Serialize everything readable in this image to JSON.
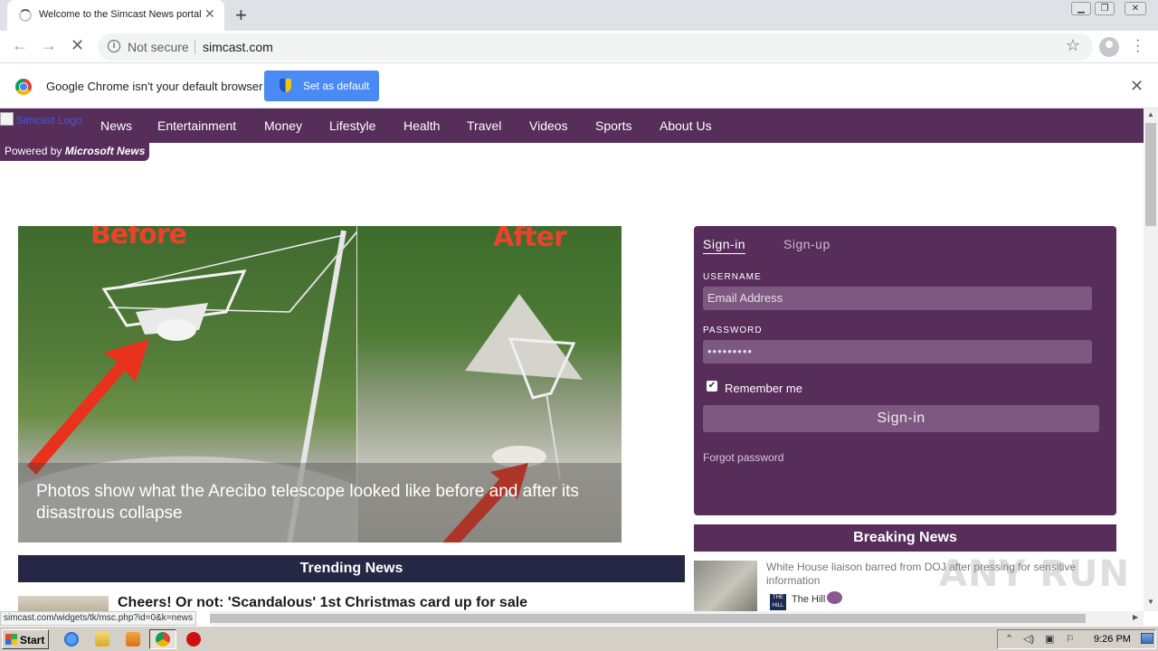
{
  "browser": {
    "tab_title": "Welcome to the Simcast News portal",
    "security_label": "Not secure",
    "url": "simcast.com",
    "infobar_message": "Google Chrome isn't your default browser",
    "set_default_label": "Set as default"
  },
  "site": {
    "logo_alt": "Simcast Logo",
    "nav": [
      "News",
      "Entertainment",
      "Money",
      "Lifestyle",
      "Health",
      "Travel",
      "Videos",
      "Sports",
      "About Us"
    ],
    "powered_prefix": "Powered by",
    "powered_brand": "Microsoft News"
  },
  "hero": {
    "before_label": "Before",
    "after_label": "After",
    "caption": "Photos show what the Arecibo telescope looked like before and after its disastrous collapse"
  },
  "trending": {
    "title": "Trending News",
    "headline": "Cheers! Or not: 'Scandalous' 1st Christmas card up for sale"
  },
  "signin": {
    "tab_signin": "Sign-in",
    "tab_signup": "Sign-up",
    "username_label": "USERNAME",
    "username_placeholder": "Email Address",
    "password_label": "PASSWORD",
    "password_value": "•••••••••",
    "remember_label": "Remember me",
    "remember_checked": true,
    "submit_label": "Sign-in",
    "forgot_label": "Forgot password"
  },
  "breaking": {
    "title": "Breaking News",
    "headline": "White House liaison barred from DOJ after pressing for sensitive information",
    "source": "The Hill",
    "source_icon_text": "THE HILL"
  },
  "status_url": "simcast.com/widgets/tk/msc.php?id=0&k=news",
  "watermark": "ANY RUN",
  "taskbar": {
    "start_label": "Start",
    "clock": "9:26 PM"
  },
  "colors": {
    "brand_purple": "#572d5a",
    "trending_navy": "#252744",
    "chrome_blue": "#4a8af4"
  }
}
